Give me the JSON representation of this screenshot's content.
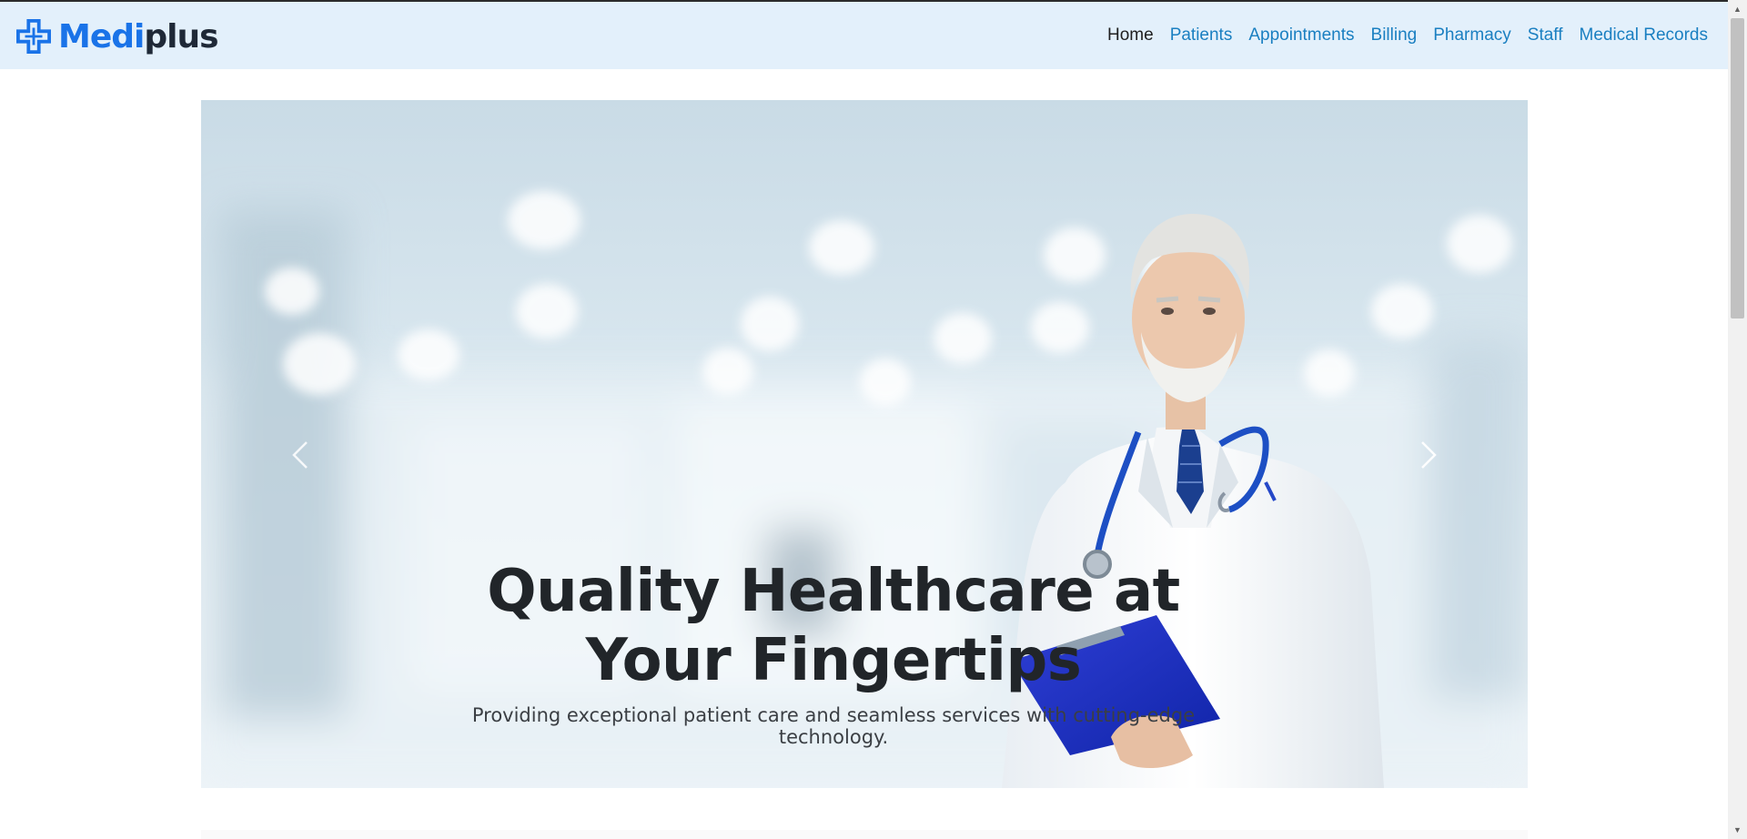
{
  "brand": {
    "part1": "Medi",
    "part2": "plus",
    "icon": "medical-cross-icon",
    "color_primary": "#1a73e8",
    "color_dark": "#1f2937"
  },
  "nav": {
    "items": [
      {
        "label": "Home",
        "active": true
      },
      {
        "label": "Patients",
        "active": false
      },
      {
        "label": "Appointments",
        "active": false
      },
      {
        "label": "Billing",
        "active": false
      },
      {
        "label": "Pharmacy",
        "active": false
      },
      {
        "label": "Staff",
        "active": false
      },
      {
        "label": "Medical Records",
        "active": false
      }
    ],
    "link_color": "#1a7fc1",
    "active_color": "#1f1f1f",
    "background": "#e3f0fb"
  },
  "hero": {
    "title": "Quality Healthcare at Your Fingertips",
    "subtitle": "Providing exceptional patient care and seamless services with cutting-edge technology.",
    "image": "doctor-with-stethoscope-and-clipboard",
    "prev_icon": "chevron-left-icon",
    "next_icon": "chevron-right-icon"
  }
}
